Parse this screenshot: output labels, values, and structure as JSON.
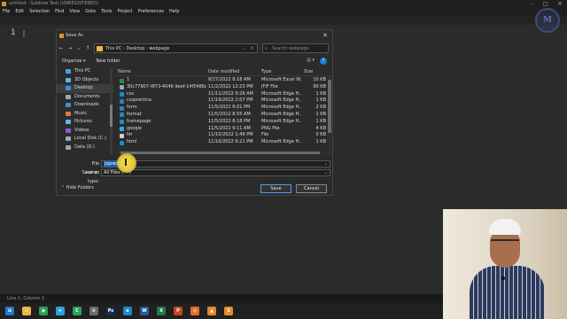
{
  "app": {
    "title": "untitled - Sublime Text (UNREGISTERED)",
    "menu": [
      "File",
      "Edit",
      "Selection",
      "Find",
      "View",
      "Goto",
      "Tools",
      "Project",
      "Preferences",
      "Help"
    ],
    "line_number": "1",
    "status": "Line 1, Column 1"
  },
  "dialog": {
    "title": "Save As",
    "path": [
      "This PC",
      "Desktop",
      "webpage"
    ],
    "search_placeholder": "Search webpage",
    "organize": "Organize",
    "new_folder": "New folder",
    "nav_items": [
      {
        "label": "This PC",
        "color": "#4aa3e8"
      },
      {
        "label": "3D Objects",
        "color": "#5bb7f0"
      },
      {
        "label": "Desktop",
        "color": "#3d8fd6"
      },
      {
        "label": "Documents",
        "color": "#9aa7b5"
      },
      {
        "label": "Downloads",
        "color": "#3d8fd6"
      },
      {
        "label": "Music",
        "color": "#e07a3b"
      },
      {
        "label": "Pictures",
        "color": "#5bb7f0"
      },
      {
        "label": "Videos",
        "color": "#8a5bd6"
      },
      {
        "label": "Local Disk (C:)",
        "color": "#9aa7b5"
      },
      {
        "label": "Data (D:)",
        "color": "#9aa7b5"
      }
    ],
    "columns": {
      "name": "Name",
      "date": "Date modified",
      "type": "Type",
      "size": "Size"
    },
    "files": [
      {
        "name": "1",
        "date": "8/27/2022 8:18 AM",
        "type": "Microsoft Excel W...",
        "size": "10 KB",
        "icon": "#2e8b4e"
      },
      {
        "name": "30c77907-f873-4046-9eef-14f5486d6a50",
        "date": "11/2/2022 12:23 PM",
        "type": "JFIF File",
        "size": "90 KB",
        "icon": "#9aa7b5"
      },
      {
        "name": "css",
        "date": "11/11/2022 9:26 AM",
        "type": "Microsoft Edge H...",
        "size": "1 KB",
        "icon": "#1e88c8"
      },
      {
        "name": "cssprectice",
        "date": "11/19/2022 2:07 PM",
        "type": "Microsoft Edge H...",
        "size": "1 KB",
        "icon": "#1e88c8"
      },
      {
        "name": "form",
        "date": "11/5/2022 6:01 PM",
        "type": "Microsoft Edge H...",
        "size": "2 KB",
        "icon": "#1e88c8"
      },
      {
        "name": "format",
        "date": "11/5/2022 8:55 AM",
        "type": "Microsoft Edge H...",
        "size": "1 KB",
        "icon": "#1e88c8"
      },
      {
        "name": "framepage",
        "date": "11/5/2022 8:18 PM",
        "type": "Microsoft Edge H...",
        "size": "1 KB",
        "icon": "#1e88c8"
      },
      {
        "name": "google",
        "date": "11/5/2022 9:11 AM",
        "type": "PNG File",
        "size": "4 KB",
        "icon": "#3ea7e0"
      },
      {
        "name": "hh",
        "date": "11/10/2022 1:46 PM",
        "type": "File",
        "size": "0 KB",
        "icon": "#cfcfcf"
      },
      {
        "name": "html",
        "date": "11/10/2022 6:21 PM",
        "type": "Microsoft Edge H...",
        "size": "1 KB",
        "icon": "#1e88c8"
      }
    ],
    "filename_label": "File name:",
    "filename_value": "jsprectice",
    "savetype_label": "Save as type:",
    "savetype_value": "All Files (*.*)",
    "hide_folders": "Hide Folders",
    "save": "Save",
    "cancel": "Cancel"
  },
  "taskbar_icons": [
    {
      "name": "windows",
      "color": "#1e78d4",
      "glyph": "⊞"
    },
    {
      "name": "file-explorer",
      "color": "#e8b943",
      "glyph": "▭"
    },
    {
      "name": "chrome",
      "color": "#2e9e4f",
      "glyph": "◉"
    },
    {
      "name": "telegram",
      "color": "#2aa3df",
      "glyph": "➤"
    },
    {
      "name": "camtasia",
      "color": "#27a35a",
      "glyph": "C"
    },
    {
      "name": "settings",
      "color": "#6b6b6b",
      "glyph": "⚙"
    },
    {
      "name": "photoshop",
      "color": "#1a2d4f",
      "glyph": "Ps"
    },
    {
      "name": "edge",
      "color": "#1e88c8",
      "glyph": "e"
    },
    {
      "name": "word",
      "color": "#2b5797",
      "glyph": "W"
    },
    {
      "name": "excel",
      "color": "#1f7a45",
      "glyph": "X"
    },
    {
      "name": "powerpoint",
      "color": "#c6451f",
      "glyph": "P"
    },
    {
      "name": "firefox",
      "color": "#e66b2a",
      "glyph": "◎"
    },
    {
      "name": "vlc",
      "color": "#e8872a",
      "glyph": "▲"
    },
    {
      "name": "sublime",
      "color": "#e08e2b",
      "glyph": "S"
    }
  ],
  "brand": {
    "logo_text": "M"
  }
}
